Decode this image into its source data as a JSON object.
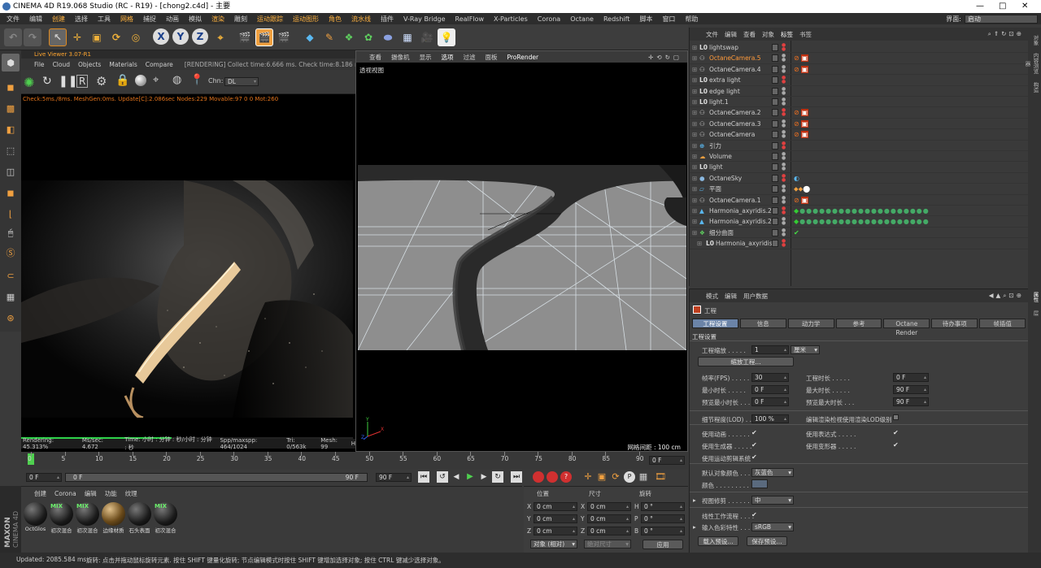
{
  "title": {
    "text": "CINEMA 4D R19.068 Studio (RC - R19) - [chong2.c4d] - 主要",
    "minimize": "—",
    "maximize": "□",
    "close": "✕"
  },
  "menu": [
    "文件",
    "编辑",
    "创建",
    "选择",
    "工具",
    "网格",
    "捕捉",
    "动画",
    "模拟",
    "渲染",
    "雕刻",
    "运动跟踪",
    "运动图形",
    "角色",
    "流水线",
    "插件",
    "V-Ray Bridge",
    "RealFlow",
    "X-Particles",
    "Corona",
    "Octane",
    "Redshift",
    "脚本",
    "窗口",
    "帮助"
  ],
  "layout": {
    "label": "界面:",
    "value": "启动"
  },
  "toolbar": {
    "x": "X",
    "y": "Y",
    "z": "Z"
  },
  "liveviewer": {
    "title": "Live Viewer 3.07-R1",
    "menu": [
      "File",
      "Cloud",
      "Objects",
      "Materials",
      "Compare"
    ],
    "status_top": "[RENDERING] Collect time:6.666 ms.  Check time:8.186 ms",
    "chn_label": "Chn:",
    "chn_value": "DL",
    "check": "Check:5ms./8ms. MeshGen:0ms. Update[C]:2.086sec Nodes:229 Movable:97  0 0 Mot:260",
    "footer": [
      "Rendering: 45.313%",
      "Ms/sec: 4.672",
      "Time: 小时 : 分钟 : 秒/小时 : 分钟 : 秒",
      "Spp/maxspp: 464/1024",
      "Tri: 0/563k",
      "Mesh: 99",
      "H"
    ],
    "progress": 0.45313
  },
  "viewport": {
    "menu": [
      "查看",
      "摄像机",
      "显示",
      "选项",
      "过滤",
      "面板",
      "ProRender"
    ],
    "label": "透视视图",
    "grid": "网格间距 : 100 cm"
  },
  "timeline": {
    "ticks": [
      "0",
      "5",
      "10",
      "15",
      "20",
      "25",
      "30",
      "35",
      "40",
      "45",
      "50",
      "55",
      "60",
      "65",
      "70",
      "75",
      "80",
      "85",
      "90"
    ],
    "end": "0 F"
  },
  "timebar": {
    "start": "0 F",
    "range_start": "0 F",
    "range_end": "90 F",
    "end": "90 F"
  },
  "materials": {
    "menu": [
      "创建",
      "Corona",
      "编辑",
      "功能",
      "纹理"
    ],
    "items": [
      {
        "label": "OctGlos",
        "mix": ""
      },
      {
        "label": "初次混合",
        "mix": "MIX"
      },
      {
        "label": "初次混合",
        "mix": "MIX"
      },
      {
        "label": "边缘材质",
        "mix": ""
      },
      {
        "label": "石头表面",
        "mix": ""
      },
      {
        "label": "初次混合",
        "mix": "MIX"
      }
    ]
  },
  "coords": {
    "headers": [
      "位置",
      "尺寸",
      "旋转"
    ],
    "rows": [
      {
        "axis": "X",
        "pos": "0 cm",
        "size_axis": "X",
        "size": "0 cm",
        "rot_axis": "H",
        "rot": "0 °"
      },
      {
        "axis": "Y",
        "pos": "0 cm",
        "size_axis": "Y",
        "size": "0 cm",
        "rot_axis": "P",
        "rot": "0 °"
      },
      {
        "axis": "Z",
        "pos": "0 cm",
        "size_axis": "Z",
        "size": "0 cm",
        "rot_axis": "B",
        "rot": "0 °"
      }
    ],
    "mode": "对象 (相对)",
    "size_mode": "绝对尺寸",
    "apply": "应用"
  },
  "status": {
    "updated": "Updated: 2085.584 ms.",
    "hint": "旋转: 点击并拖动鼠标旋转元素. 按住 SHIFT 键量化旋转; 节点编辑模式时按住 SHIFT 键增加选择对象; 按住 CTRL 键减少选择对象。"
  },
  "objects": {
    "menu": [
      "文件",
      "编辑",
      "查看",
      "对象",
      "标签",
      "书签"
    ],
    "items": [
      {
        "name": "lightswap",
        "indent": 0,
        "icon": "L0",
        "hl": false
      },
      {
        "name": "OctaneCamera.5",
        "indent": 0,
        "icon": "cam",
        "hl": true
      },
      {
        "name": "OctaneCamera.4",
        "indent": 0,
        "icon": "cam",
        "hl": false
      },
      {
        "name": "extra light",
        "indent": 0,
        "icon": "L0",
        "hl": false
      },
      {
        "name": "edge light",
        "indent": 0,
        "icon": "L0",
        "hl": false
      },
      {
        "name": "light.1",
        "indent": 0,
        "icon": "L0",
        "hl": false
      },
      {
        "name": "OctaneCamera.2",
        "indent": 0,
        "icon": "cam",
        "hl": false
      },
      {
        "name": "OctaneCamera.3",
        "indent": 0,
        "icon": "cam",
        "hl": false
      },
      {
        "name": "OctaneCamera",
        "indent": 0,
        "icon": "cam",
        "hl": false
      },
      {
        "name": "引力",
        "indent": 0,
        "icon": "force",
        "hl": false
      },
      {
        "name": "Volume",
        "indent": 0,
        "icon": "vol",
        "hl": false
      },
      {
        "name": "light",
        "indent": 0,
        "icon": "L0",
        "hl": false
      },
      {
        "name": "OctaneSky",
        "indent": 0,
        "icon": "sky",
        "hl": false
      },
      {
        "name": "平面",
        "indent": 0,
        "icon": "plane",
        "hl": false
      },
      {
        "name": "OctaneCamera.1",
        "indent": 0,
        "icon": "cam",
        "hl": false
      },
      {
        "name": "Harmonia_axyridis.2",
        "indent": 0,
        "icon": "mesh",
        "hl": false
      },
      {
        "name": "Harmonia_axyridis.2",
        "indent": 0,
        "icon": "mesh",
        "hl": false
      },
      {
        "name": "细分曲面",
        "indent": 0,
        "icon": "sub",
        "hl": false
      },
      {
        "name": "Harmonia_axyridis",
        "indent": 1,
        "icon": "L0",
        "hl": false
      }
    ]
  },
  "attributes": {
    "menu": [
      "模式",
      "编辑",
      "用户数据"
    ],
    "object": "工程",
    "tabs": [
      "工程设置",
      "信息",
      "动力学",
      "参考",
      "Octane Render",
      "待办事项",
      "帧插值"
    ],
    "section": "工程设置",
    "scale_label": "工程缩放 . . . . .",
    "scale_value": "1",
    "scale_unit": "厘米",
    "scale_button": "缩放工程...",
    "fps_label": "帧率(FPS) . . . . .",
    "fps": "30",
    "dur_label": "工程时长 . . . . .",
    "dur": "0 F",
    "min_label": "最小时长 . . . . .",
    "min": "0 F",
    "max_label": "最大时长 . . . . .",
    "max": "90 F",
    "pmin_label": "预览最小时长 . . .",
    "pmin": "0 F",
    "pmax_label": "预览最大时长 . . .",
    "pmax": "90 F",
    "lod_label": "细节程度(LOD) . . .",
    "lod": "100 %",
    "lod2_label": "编辑渲染检视使用渲染LOD级别",
    "anim_label": "使用动画 . . . . . .",
    "expr_label": "使用表达式 . . . . .",
    "gen_label": "使用生成器 . . . . .",
    "def_label": "使用变形器 . . . . .",
    "motion_label": "使用运动剪辑系统",
    "color_label": "默认对象颜色 . . .",
    "color_value": "灰蓝色",
    "col_label": "颜色 . . . . . . . . .",
    "clip_label": "视图修剪 . . . . . .",
    "clip_value": "中",
    "linear_label": "线性工作流程 . . . .",
    "profile_label": "输入色彩特性 . . .",
    "profile_value": "sRGB",
    "load": "载入预设...",
    "save": "保存预设..."
  },
  "side_tabs": [
    "对象",
    "内容浏览器",
    "构造",
    "属性",
    "层"
  ]
}
